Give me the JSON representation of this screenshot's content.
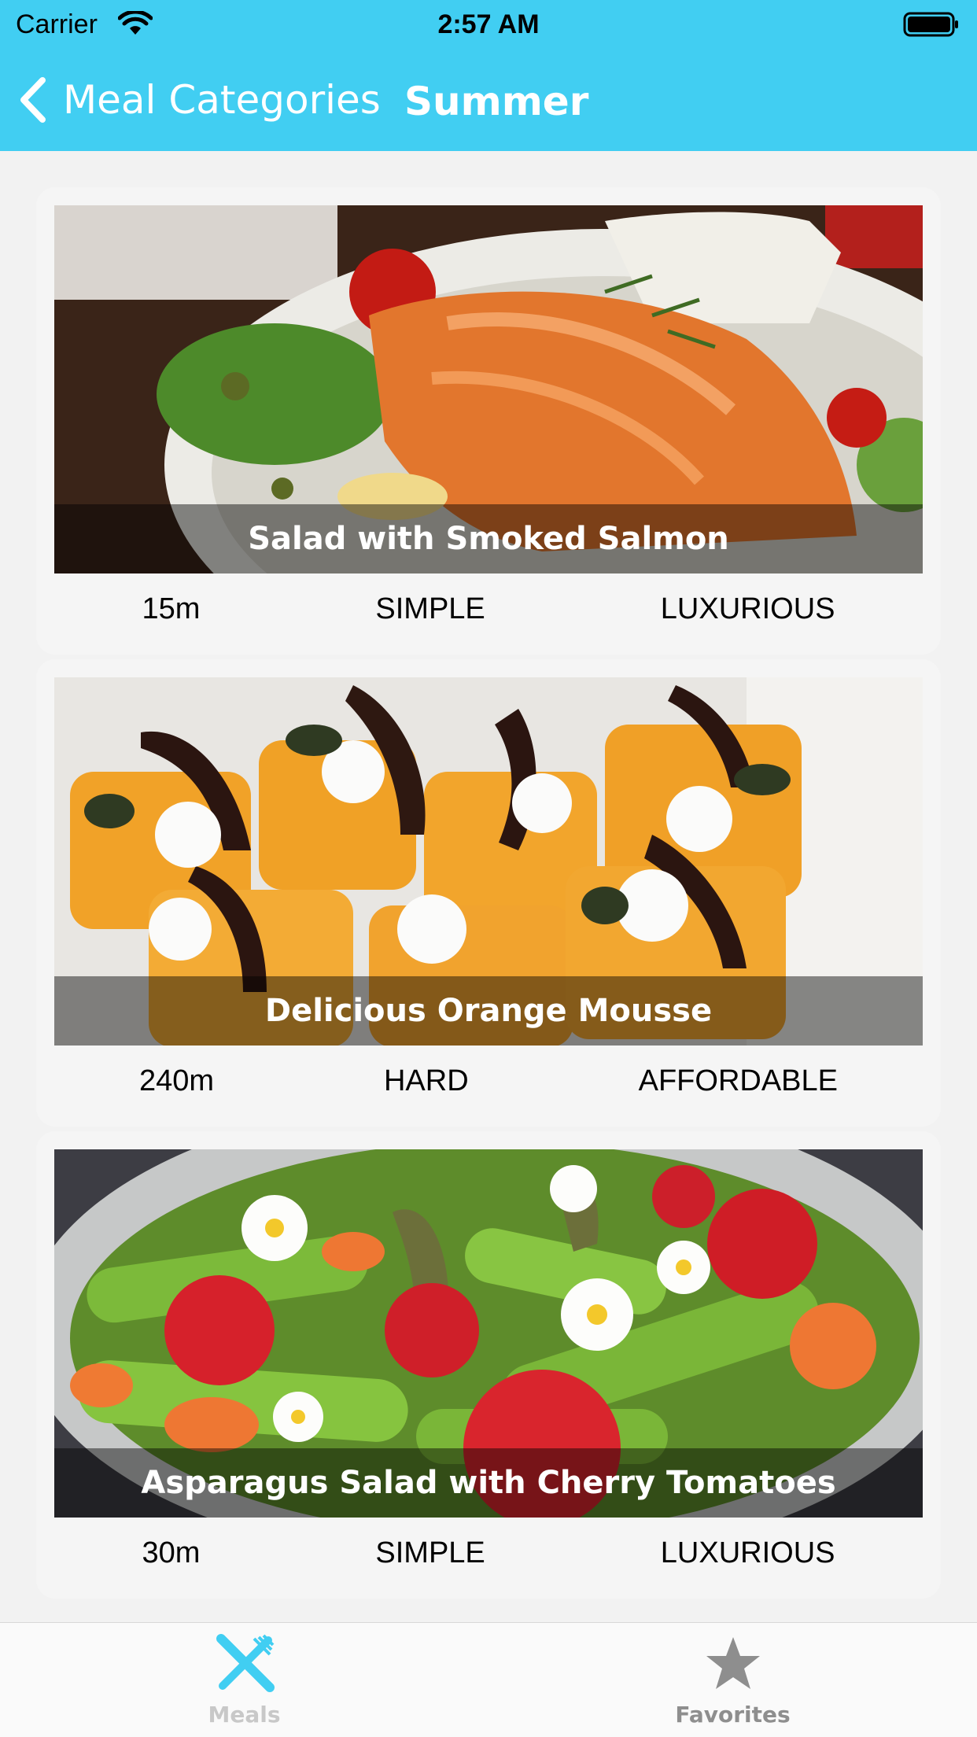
{
  "status_bar": {
    "carrier": "Carrier",
    "time": "2:57 AM"
  },
  "nav": {
    "back_label": "Meal Categories",
    "title": "Summer"
  },
  "meals": [
    {
      "title": "Salad with Smoked Salmon",
      "duration": "15m",
      "complexity": "SIMPLE",
      "affordability": "LUXURIOUS"
    },
    {
      "title": "Delicious Orange Mousse",
      "duration": "240m",
      "complexity": "HARD",
      "affordability": "AFFORDABLE"
    },
    {
      "title": "Asparagus Salad with Cherry Tomatoes",
      "duration": "30m",
      "complexity": "SIMPLE",
      "affordability": "LUXURIOUS"
    }
  ],
  "tabs": [
    {
      "label": "Meals",
      "icon": "utensils-icon",
      "active": true
    },
    {
      "label": "Favorites",
      "icon": "star-icon",
      "active": false
    }
  ],
  "colors": {
    "header": "#41cef2",
    "active_tab_icon": "#41cef2",
    "inactive_tab_icon": "#8e8e8e"
  }
}
